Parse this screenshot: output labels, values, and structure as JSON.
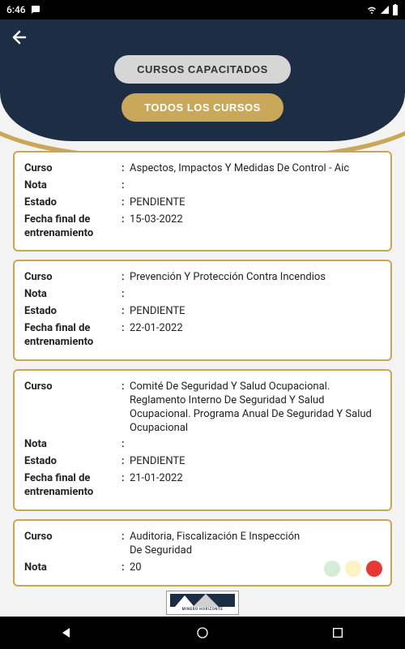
{
  "status": {
    "time": "6:46",
    "icons": {
      "chat": "chat-bubble-icon",
      "wifi": "wifi-icon",
      "signal": "signal-icon",
      "battery": "battery-icon"
    }
  },
  "header": {
    "tab_capacitados": "CURSOS CAPACITADOS",
    "tab_todos": "TODOS LOS CURSOS"
  },
  "labels": {
    "curso": "Curso",
    "nota": "Nota",
    "estado": "Estado",
    "fecha": "Fecha final de entrenamiento"
  },
  "courses": [
    {
      "curso": "Aspectos, Impactos Y Medidas De Control - Aic",
      "nota": "",
      "estado": "PENDIENTE",
      "fecha": "15-03-2022"
    },
    {
      "curso": "Prevención Y Protección Contra Incendios",
      "nota": "",
      "estado": "PENDIENTE",
      "fecha": "22-01-2022"
    },
    {
      "curso": "Comité De Seguridad Y Salud Ocupacional. Reglamento Interno De Seguridad Y Salud Ocupacional. Programa Anual De Seguridad Y Salud Ocupacional",
      "nota": "",
      "estado": "PENDIENTE",
      "fecha": "21-01-2022"
    },
    {
      "curso": "Auditoria, Fiscalización E Inspección De Seguridad",
      "nota": "20",
      "estado": "",
      "fecha": ""
    }
  ],
  "footer": {
    "brand": "MINERO HORIZONTE"
  }
}
